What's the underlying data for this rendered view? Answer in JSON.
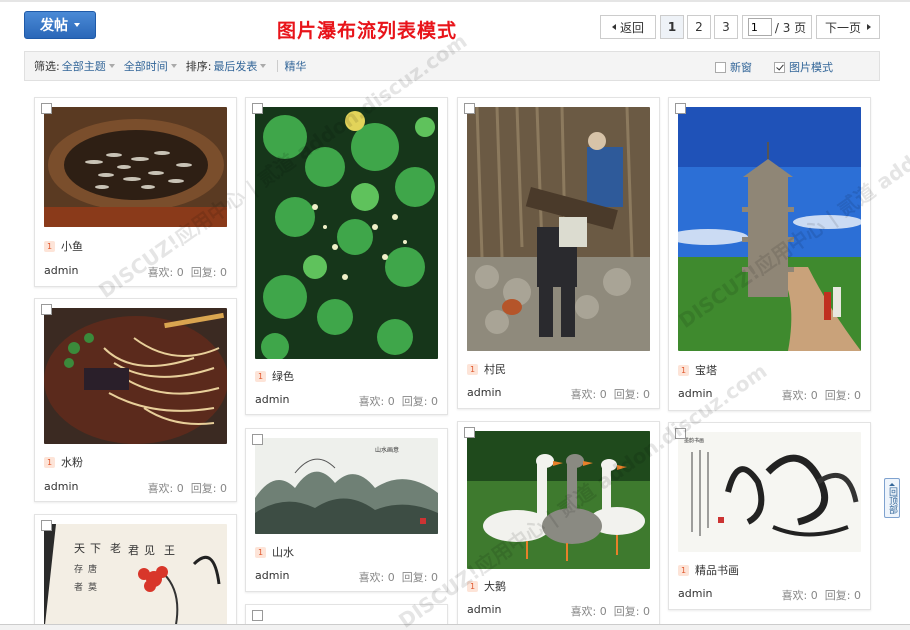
{
  "header": {
    "post_button": "发帖",
    "banner": "图片瀑布流列表模式"
  },
  "pager": {
    "back": "返回",
    "pages": [
      "1",
      "2",
      "3"
    ],
    "active_page": "1",
    "input_value": "1",
    "total": "/ 3 页",
    "next": "下一页"
  },
  "filter": {
    "filter_label": "筛选:",
    "all_topics": "全部主题",
    "all_time": "全部时间",
    "sort_label": "排序:",
    "sort_value": "最后发表",
    "digest": "精华",
    "new_window": "新窗",
    "picture_mode": "图片模式",
    "new_window_checked": false,
    "picture_mode_checked": true
  },
  "scroll_top": "回顶部",
  "watermark": "DISCUZ!应用中心 | 贰道 addon.discuz.com",
  "labels": {
    "badge": "1",
    "author": "admin",
    "likes_label": "喜欢:",
    "replies_label": "回复:"
  },
  "cards": [
    {
      "title": "小鱼",
      "author": "admin",
      "likes": "0",
      "replies": "0",
      "icon": "fish-basket-photo"
    },
    {
      "title": "水粉",
      "author": "admin",
      "likes": "0",
      "replies": "0",
      "icon": "noodle-bowl-photo"
    },
    {
      "title": "",
      "author": "",
      "likes": "",
      "replies": "",
      "icon": "flower-painting-photo"
    },
    {
      "title": "绿色",
      "author": "admin",
      "likes": "0",
      "replies": "0",
      "icon": "green-plants-photo"
    },
    {
      "title": "山水",
      "author": "admin",
      "likes": "0",
      "replies": "0",
      "icon": "ink-landscape-photo"
    },
    {
      "title": "村民",
      "author": "admin",
      "likes": "0",
      "replies": "0",
      "icon": "villagers-photo"
    },
    {
      "title": "大鹅",
      "author": "admin",
      "likes": "0",
      "replies": "0",
      "icon": "geese-photo"
    },
    {
      "title": "宝塔",
      "author": "admin",
      "likes": "0",
      "replies": "0",
      "icon": "pagoda-photo"
    },
    {
      "title": "精品书画",
      "author": "admin",
      "likes": "0",
      "replies": "0",
      "icon": "calligraphy-photo"
    }
  ],
  "colors": {
    "accent": "#2a67b8",
    "banner_red": "#e8141a",
    "link": "#336699"
  }
}
